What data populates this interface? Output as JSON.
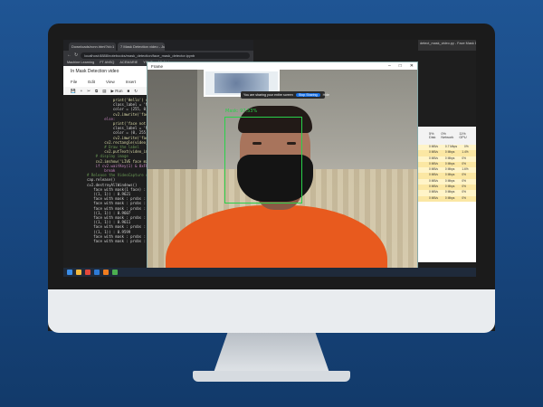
{
  "browser": {
    "tabs": [
      "Downloads/rcnn.html?id=1",
      "7 Mask Detection video - Jupy..."
    ],
    "address": "localhost:8888/notebooks/mask_detection/face_mask_detector.ipynb",
    "bookmarks": [
      "Machine Learning",
      "FT ANSQ",
      "ACEMARIE",
      "YOLO",
      "ML Notes"
    ]
  },
  "notebook": {
    "title": "In Mask Detection video",
    "menu": [
      "File",
      "Edit",
      "View",
      "Insert",
      "Cell",
      "Kernel"
    ],
    "tools": [
      "💾",
      "+",
      "✂",
      "⧉",
      "▤",
      "▶ Run",
      "■",
      "↻"
    ]
  },
  "frame_window": {
    "title": "Frame",
    "share_text": "You are sharing your entire screen",
    "share_button": "Stop Sharing",
    "hide_button": "Hide",
    "detection_label": "Mask: 97.53%"
  },
  "vscode": {
    "header": "detect_mask_video.py - Face Mask Detection - Visual Studio Code"
  },
  "taskmgr": {
    "columns": [
      "5%",
      "0%",
      "11%"
    ],
    "column_labels": [
      "Disk",
      "Network",
      "GPU"
    ],
    "rows": [
      [
        "0 MB/s",
        "0.7 Mbps",
        "0%"
      ],
      [
        "0 MB/s",
        "0 Mbps",
        "1.4%"
      ],
      [
        "0 MB/s",
        "0 Mbps",
        "0%"
      ],
      [
        "0 MB/s",
        "0 Mbps",
        "0%"
      ],
      [
        "0 MB/s",
        "0 Mbps",
        "1.6%"
      ],
      [
        "0 MB/s",
        "0 Mbps",
        "0%"
      ],
      [
        "0 MB/s",
        "0 Mbps",
        "0%"
      ],
      [
        "0 MB/s",
        "0 Mbps",
        "0%"
      ],
      [
        "0 MB/s",
        "0 Mbps",
        "0%"
      ],
      [
        "0 MB/s",
        "0 Mbps",
        "0%"
      ]
    ]
  },
  "code_lines": [
    "            print('Hello') or = 2",
    "            class_label = 'Mask'",
    "            color = (255, 0, 0)",
    "            cv2.imwrite('faces/mask.jpg', face)",
    "",
    "        else:",
    "            print('face not found')",
    "            class_label = 'No Mask'",
    "            color = (0, 255, 0)",
    "            cv2.imwrite('faces/no_mask.jpg')",
    "",
    "        cv2.rectangle(video_img, (x,y), (x+w,y+h), color, 2)",
    "        # Draw the label",
    "        cv2.putText(video_img, class_label)",
    "",
    "    # display image",
    "    cv2.imshow('LIVE face mask detection', video_img)",
    "",
    "    if cv2.waitKey(1) & 0xFF == ord('q'):",
    "        break",
    "",
    "# Release the VideoCapture object",
    "cap.release()",
    "cv2.destroyAllWindows()",
    "",
    "   face with mask(1 face) : 1 class",
    "   ((1, 1)) : 0.9621",
    "   face with mask : probs : 0.9621",
    "   face with mask : probs : 0.9617",
    "   face with mask : probs : 0.9624",
    "   ((1, 1)) : 0.9607",
    "   face with mask : probs : 0.9609",
    "   ((1, 1)) : 0.9611",
    "   face with mask : probs : 0.9601",
    "   ((1, 1)) : 0.9599",
    "   face with mask : probs : 0.9604",
    "   face with mask : probs : 0.9603"
  ]
}
